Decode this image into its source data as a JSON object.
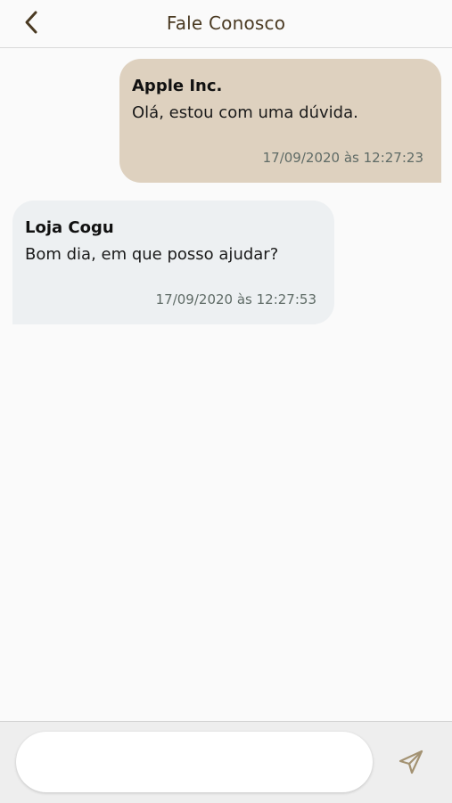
{
  "header": {
    "title": "Fale Conosco",
    "back_icon": "chevron-left-icon"
  },
  "messages": [
    {
      "direction": "sent",
      "sender": "Apple Inc.",
      "text": "Olá, estou com uma dúvida.",
      "timestamp": "17/09/2020 às 12:27:23"
    },
    {
      "direction": "received",
      "sender": "Loja Cogu",
      "text": "Bom dia, em que posso ajudar?",
      "timestamp": "17/09/2020 às 12:27:53"
    }
  ],
  "composer": {
    "placeholder": "",
    "value": "",
    "send_icon": "send-icon"
  },
  "colors": {
    "accent": "#4a3a22",
    "sent_bubble": "#ded1bf",
    "received_bubble": "#edf0f2",
    "send_icon": "#a39272"
  }
}
